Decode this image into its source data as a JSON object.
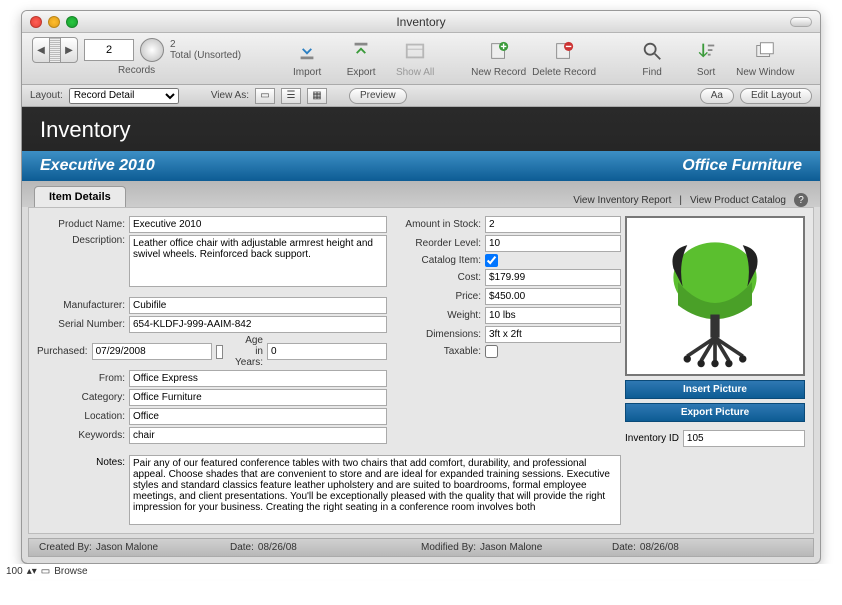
{
  "window": {
    "title": "Inventory"
  },
  "toolbar": {
    "record_current": "2",
    "record_total_line1": "2",
    "record_total_line2": "Total (Unsorted)",
    "records_label": "Records",
    "import": "Import",
    "export": "Export",
    "show_all": "Show All",
    "new_record": "New Record",
    "delete_record": "Delete Record",
    "find": "Find",
    "sort": "Sort",
    "new_window": "New Window"
  },
  "subbar": {
    "layout_label": "Layout:",
    "layout_value": "Record Detail",
    "view_as": "View As:",
    "preview": "Preview",
    "edit_layout": "Edit Layout",
    "aa": "Aa"
  },
  "page": {
    "title": "Inventory",
    "band_left": "Executive 2010",
    "band_right": "Office Furniture"
  },
  "tabs": {
    "item_details": "Item Details",
    "link_report": "View Inventory Report",
    "link_catalog": "View Product Catalog"
  },
  "labels": {
    "product_name": "Product Name:",
    "description": "Description:",
    "manufacturer": "Manufacturer:",
    "serial_number": "Serial Number:",
    "purchased": "Purchased:",
    "age_in_years": "Age in Years:",
    "from": "From:",
    "category": "Category:",
    "location": "Location:",
    "keywords": "Keywords:",
    "notes": "Notes:",
    "amount_in_stock": "Amount in Stock:",
    "reorder_level": "Reorder Level:",
    "catalog_item": "Catalog Item:",
    "cost": "Cost:",
    "price": "Price:",
    "weight": "Weight:",
    "dimensions": "Dimensions:",
    "taxable": "Taxable:",
    "insert_picture": "Insert Picture",
    "export_picture": "Export Picture",
    "inventory_id": "Inventory ID",
    "created_by": "Created By:",
    "date": "Date:",
    "modified_by": "Modified By:"
  },
  "values": {
    "product_name": "Executive 2010",
    "description": "Leather office chair with adjustable armrest height and swivel wheels. Reinforced back support.",
    "manufacturer": "Cubifile",
    "serial_number": "654-KLDFJ-999-AAIM-842",
    "purchased": "07/29/2008",
    "age_in_years": "0",
    "from": "Office Express",
    "category": "Office Furniture",
    "location": "Office",
    "keywords": "chair",
    "notes": "Pair any of our featured conference tables with two chairs that add comfort, durability, and professional appeal. Choose shades that are convenient to store and are ideal for expanded training sessions. Executive styles and standard classics feature leather upholstery and are suited to boardrooms, formal employee meetings, and client presentations. You'll be exceptionally pleased with the quality that will provide the right impression for your business. Creating the right seating in a conference room involves both",
    "amount_in_stock": "2",
    "reorder_level": "10",
    "cost": "$179.99",
    "price": "$450.00",
    "weight": "10 lbs",
    "dimensions": "3ft x 2ft",
    "inventory_id": "105",
    "created_by": "Jason Malone",
    "created_date": "08/26/08",
    "modified_by": "Jason Malone",
    "modified_date": "08/26/08"
  },
  "status": {
    "zoom": "100",
    "mode": "Browse"
  }
}
